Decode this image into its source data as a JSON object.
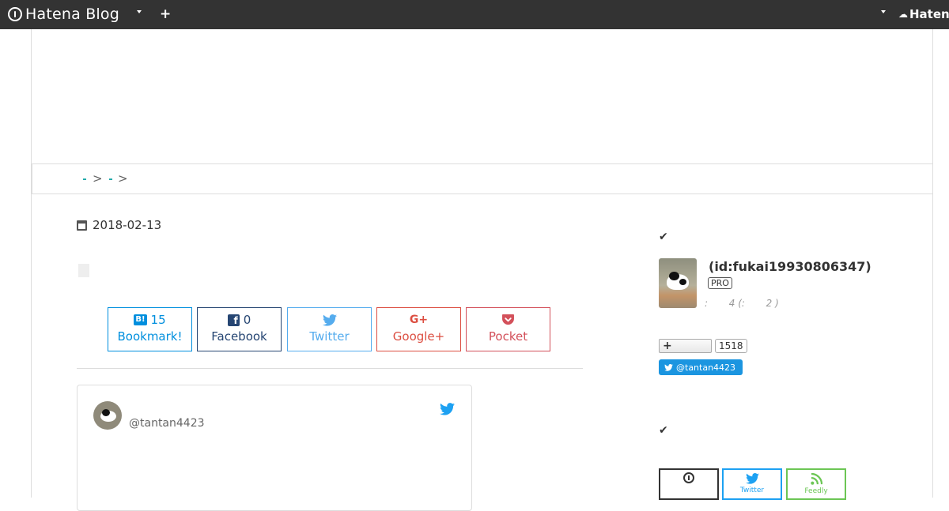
{
  "topbar": {
    "logo_text": "Hatena Blog",
    "right_label": "Hatena",
    "accent": "#333333"
  },
  "breadcrumb": {
    "separators": [
      ">",
      ">"
    ]
  },
  "article": {
    "date": "2018-02-13"
  },
  "share": {
    "buttons": [
      {
        "name": "hatena-bookmark",
        "count": "15",
        "label": "Bookmark!",
        "color": "#008fde"
      },
      {
        "name": "facebook",
        "count": "0",
        "label": "Facebook",
        "color": "#264673"
      },
      {
        "name": "twitter",
        "count": "",
        "label": "Twitter",
        "color": "#55acee"
      },
      {
        "name": "google-plus",
        "count": "",
        "label": "Google+",
        "color": "#dc4e41"
      },
      {
        "name": "pocket",
        "count": "",
        "label": "Pocket",
        "color": "#d3505a"
      }
    ]
  },
  "tweet": {
    "username": "@tantan4423"
  },
  "sidebar": {
    "profile": {
      "id": "(id:fukai19930806347)",
      "badge": "PRO",
      "stats": ":       4 (:       2 )"
    },
    "follow_count": "1518",
    "twitter_follow": "@tantan4423",
    "subscribe": [
      {
        "label": "",
        "color": "#333333"
      },
      {
        "label": "Twitter",
        "color": "#1da1f2"
      },
      {
        "label": "Feedly",
        "color": "#6cc655"
      }
    ]
  }
}
